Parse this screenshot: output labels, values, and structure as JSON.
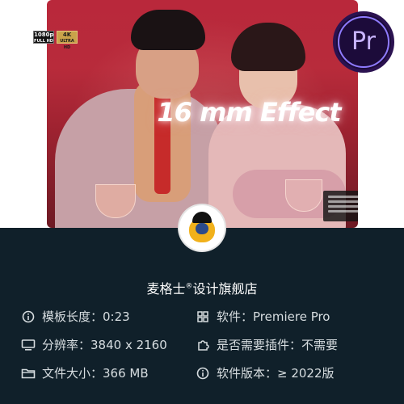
{
  "hero": {
    "badges": {
      "fullhd_top": "1080p",
      "fullhd_bottom": "FULL HD",
      "uhd_top": "4K",
      "uhd_bottom": "ULTRA HD"
    },
    "title": "16 mm Effect",
    "app_logo": "Pr"
  },
  "store_name": "麦格士",
  "store_mark": "®",
  "store_suffix": "设计旗舰店",
  "specs": {
    "duration": "模板长度：0:23",
    "resolution": "分辨率：3840 x 2160",
    "file_size": "文件大小：366 MB",
    "software": "软件：Premiere Pro",
    "plugin": "是否需要插件：不需要",
    "version": "软件版本：≥ 2022版"
  },
  "colors": {
    "accent": "#f1b11b",
    "panel_bg": "#10202a",
    "pr_purple": "#8f7bff"
  }
}
